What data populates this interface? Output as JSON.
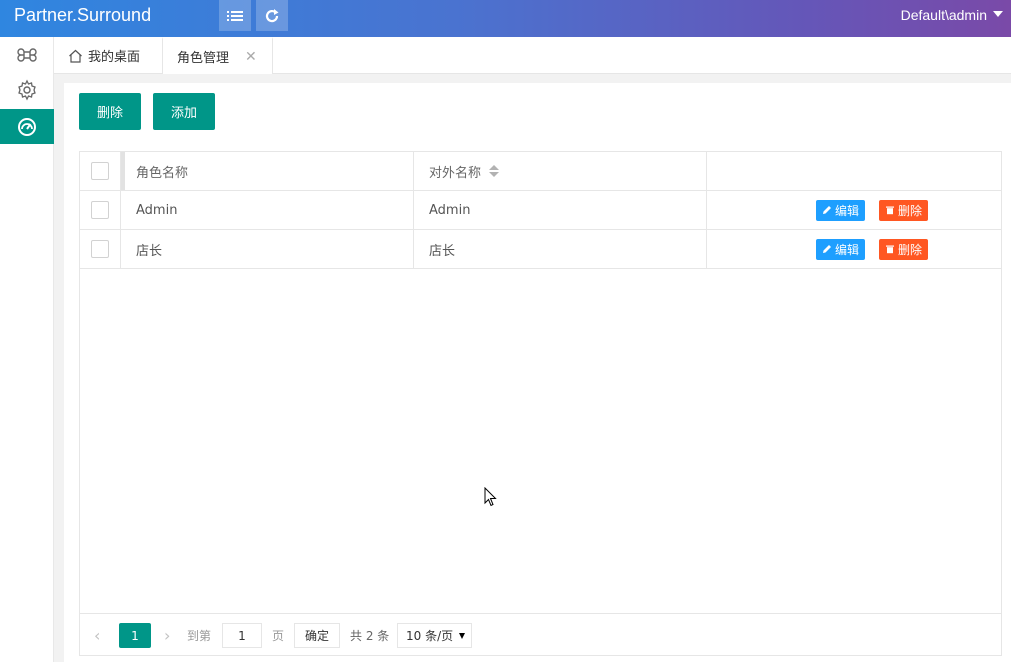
{
  "header": {
    "brand": "Partner.Surround",
    "user": "Default\\admin",
    "menu_icon": "list-icon",
    "refresh_icon": "refresh-icon",
    "gradient_start": "#2f86e0",
    "gradient_end": "#7a4aa8"
  },
  "sidebar": {
    "items": [
      {
        "icon": "command-icon",
        "active": false
      },
      {
        "icon": "gear-icon",
        "active": false
      },
      {
        "icon": "dashboard-icon",
        "active": true
      }
    ],
    "active_color": "#009688"
  },
  "tabs": {
    "home_label": "我的桌面",
    "active_label": "角色管理",
    "close_glyph": "✕"
  },
  "toolbar": {
    "delete_label": "删除",
    "add_label": "添加"
  },
  "table": {
    "columns": [
      "角色名称",
      "对外名称"
    ],
    "rows": [
      {
        "name": "Admin",
        "external": "Admin"
      },
      {
        "name": "店长",
        "external": "店长"
      }
    ],
    "edit_label": "编辑",
    "remove_label": "删除"
  },
  "pager": {
    "current_page": "1",
    "goto_label": "到第",
    "page_input": "1",
    "page_word": "页",
    "confirm_label": "确定",
    "total_label": "共 2 条",
    "page_size": "10 条/页"
  }
}
